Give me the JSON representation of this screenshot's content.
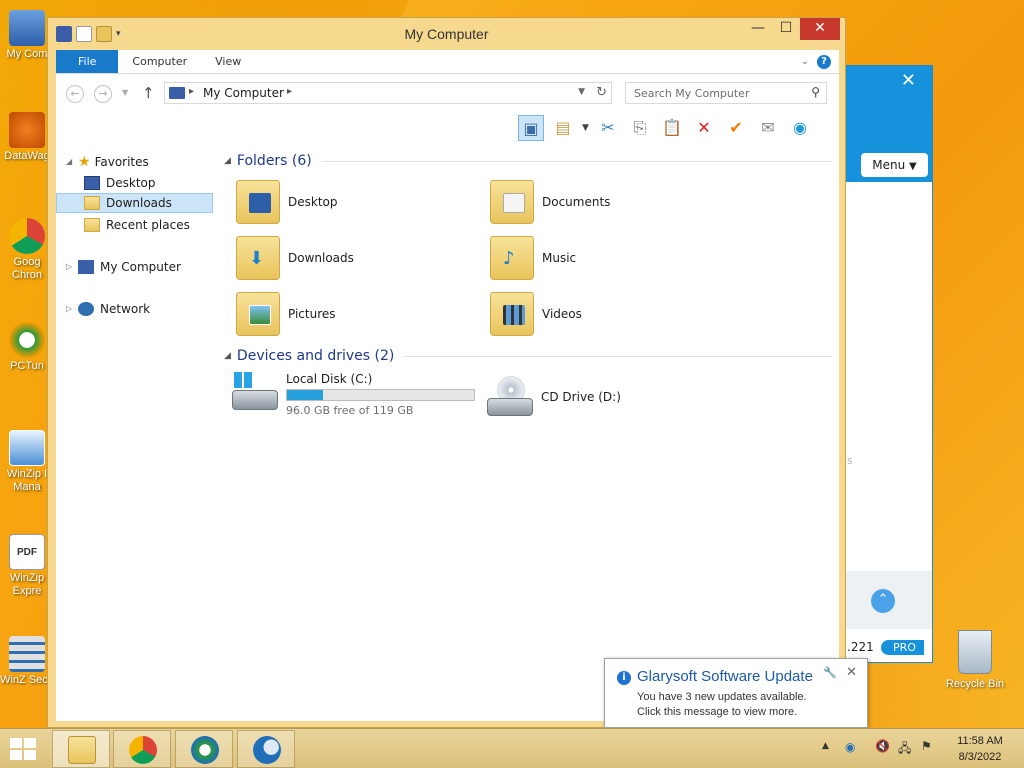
{
  "desktop": {
    "icons": [
      {
        "label": "My Com"
      },
      {
        "label": "DataWag"
      },
      {
        "label": "Goog Chron"
      },
      {
        "label": "PCTun"
      },
      {
        "label": "WinZip I Mana"
      },
      {
        "label": "WinZip Expre"
      },
      {
        "label": "WinZ Secu"
      }
    ],
    "recycle_bin": "Recycle Bin"
  },
  "glary": {
    "menu": "Menu",
    "close": "✕",
    "faint": "s",
    "version": ".221",
    "pro": "PRO"
  },
  "window": {
    "title": "My Computer",
    "min": "—",
    "max": "☐",
    "close": "✕",
    "tabs": {
      "file": "File",
      "computer": "Computer",
      "view": "View"
    },
    "help": "?"
  },
  "address": {
    "path": "My Computer",
    "search_placeholder": "Search My Computer"
  },
  "nav": {
    "favorites": "Favorites",
    "desktop": "Desktop",
    "downloads": "Downloads",
    "recent": "Recent places",
    "my_computer": "My Computer",
    "network": "Network"
  },
  "content": {
    "folders_header": "Folders (6)",
    "folders": [
      {
        "name": "Desktop"
      },
      {
        "name": "Documents"
      },
      {
        "name": "Downloads"
      },
      {
        "name": "Music"
      },
      {
        "name": "Pictures"
      },
      {
        "name": "Videos"
      }
    ],
    "devices_header": "Devices and drives (2)",
    "drives": {
      "c_name": "Local Disk (C:)",
      "c_free": "96.0 GB free of 119 GB",
      "c_used_fraction": 0.193,
      "d_name": "CD Drive (D:)"
    }
  },
  "notification": {
    "title": "Glarysoft Software Update",
    "line1": "You have 3 new updates available.",
    "line2": "Click this message to view more."
  },
  "taskbar": {
    "time": "11:58 AM",
    "date": "8/3/2022"
  },
  "colors": {
    "accent": "#1979ca",
    "selection": "#cce4f7",
    "drive_bar": "#26a0da",
    "title_close": "#c7392c"
  }
}
